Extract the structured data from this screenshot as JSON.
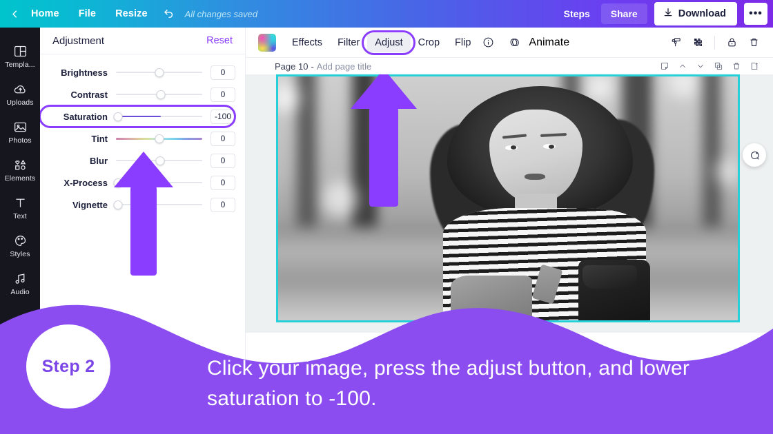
{
  "topbar": {
    "back_icon": "chevron-left-icon",
    "home": "Home",
    "file": "File",
    "resize": "Resize",
    "undo_icon": "undo-icon",
    "saved_status": "All changes saved",
    "steps": "Steps",
    "share": "Share",
    "download": "Download",
    "download_icon": "download-icon",
    "more": "•••",
    "brand_gradient_start": "#00c4cc",
    "brand_gradient_end": "#7d2ae8"
  },
  "sidebar": {
    "items": [
      {
        "label": "Templa...",
        "icon": "templates-icon"
      },
      {
        "label": "Uploads",
        "icon": "upload-cloud-icon"
      },
      {
        "label": "Photos",
        "icon": "photo-icon"
      },
      {
        "label": "Elements",
        "icon": "shapes-icon"
      },
      {
        "label": "Text",
        "icon": "text-icon"
      },
      {
        "label": "Styles",
        "icon": "palette-icon"
      },
      {
        "label": "Audio",
        "icon": "music-note-icon"
      }
    ]
  },
  "panel": {
    "title": "Adjustment",
    "reset": "Reset",
    "highlight_color": "#8b3dff",
    "sliders": [
      {
        "label": "Brightness",
        "value": "0",
        "knob_pct": 50,
        "fill_pct": 0,
        "type": "plain"
      },
      {
        "label": "Contrast",
        "value": "0",
        "knob_pct": 52,
        "fill_pct": 0,
        "type": "plain"
      },
      {
        "label": "Saturation",
        "value": "-100",
        "knob_pct": 2,
        "fill_pct": 52,
        "type": "filled",
        "highlighted": true
      },
      {
        "label": "Tint",
        "value": "0",
        "knob_pct": 50,
        "fill_pct": 0,
        "type": "rainbow"
      },
      {
        "label": "Blur",
        "value": "0",
        "knob_pct": 51,
        "fill_pct": 0,
        "type": "plain"
      },
      {
        "label": "X-Process",
        "value": "0",
        "knob_pct": 2,
        "fill_pct": 0,
        "type": "plain"
      },
      {
        "label": "Vignette",
        "value": "0",
        "knob_pct": 2,
        "fill_pct": 0,
        "type": "plain"
      }
    ]
  },
  "editor_toolbar": {
    "swatch_icon": "color-gradient-swatch-icon",
    "tools": [
      {
        "label": "Effects",
        "active": false
      },
      {
        "label": "Filter",
        "active": false
      },
      {
        "label": "Adjust",
        "active": true
      },
      {
        "label": "Crop",
        "active": false
      },
      {
        "label": "Flip",
        "active": false
      }
    ],
    "info_icon": "info-circle-icon",
    "animate": "Animate",
    "animate_icon": "animate-icon",
    "right_icons": [
      "paint-roller-icon",
      "transparency-icon",
      "lock-icon",
      "trash-icon"
    ]
  },
  "page_row": {
    "page_number": "Page 10",
    "separator": "-",
    "title_placeholder": "Add page title",
    "actions": [
      "note-icon",
      "chevron-up-icon",
      "chevron-down-icon",
      "duplicate-icon",
      "trash-icon",
      "add-page-icon"
    ]
  },
  "canvas": {
    "selection_color": "#25d0d8",
    "photo_description": "Grayscale photo of a woman with curly hair wearing a striped shirt and overalls with a backpack in a park",
    "comment_fab_icon": "add-comment-icon",
    "arrow_color": "#8b3dff"
  },
  "banner": {
    "background": "#8b4df0",
    "step_label": "Step 2",
    "instruction": "Click your image, press the adjust button, and lower saturation to -100."
  }
}
